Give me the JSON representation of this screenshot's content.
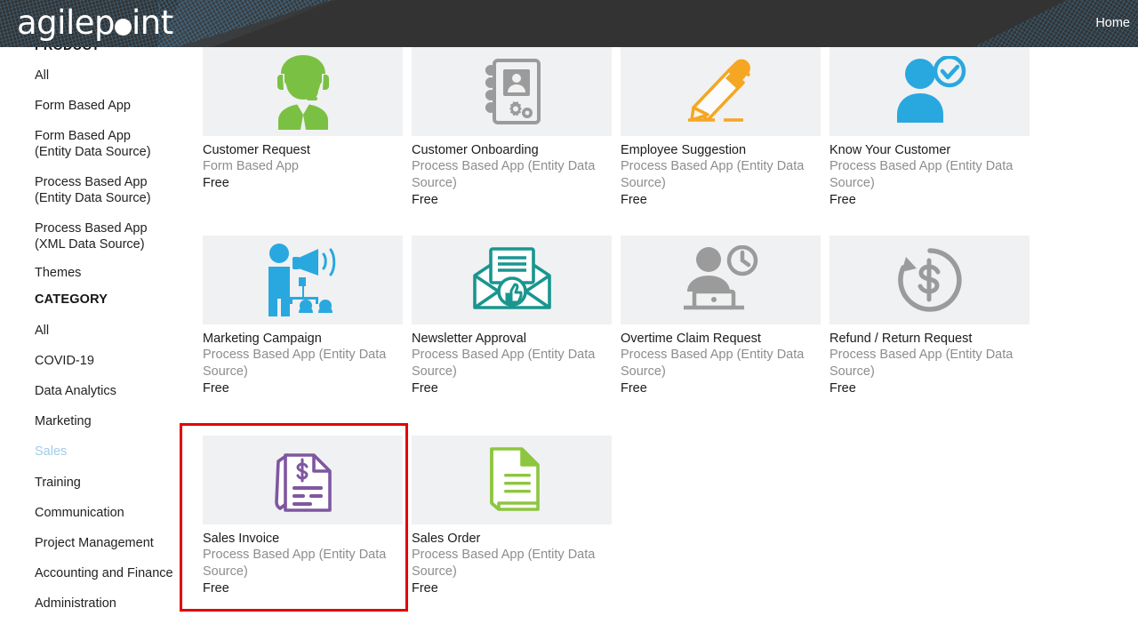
{
  "header": {
    "logo_text": "agilepoint",
    "logo_parts": {
      "pre": "agilep",
      "post": "int"
    },
    "nav": [
      {
        "label": "Home",
        "name": "home-link"
      }
    ],
    "bg_color": "#333333",
    "accent_color": "#4684b0"
  },
  "sidebar": {
    "groups": [
      {
        "title": "PRODUCT",
        "clipped": true,
        "items": [
          {
            "label": "All",
            "selected": false
          },
          {
            "label": "Form Based App",
            "selected": false
          },
          {
            "label": "Form Based App (Entity Data Source)",
            "selected": false
          },
          {
            "label": "Process Based App (Entity Data Source)",
            "selected": false
          },
          {
            "label": "Process Based App (XML Data Source)",
            "selected": false
          },
          {
            "label": "Themes",
            "selected": false
          }
        ]
      },
      {
        "title": "CATEGORY",
        "clipped": false,
        "items": [
          {
            "label": "All",
            "selected": false
          },
          {
            "label": "COVID-19",
            "selected": false
          },
          {
            "label": "Data Analytics",
            "selected": false
          },
          {
            "label": "Marketing",
            "selected": false
          },
          {
            "label": "Sales",
            "selected": true
          },
          {
            "label": "Training",
            "selected": false
          },
          {
            "label": "Communication",
            "selected": false
          },
          {
            "label": "Project Management",
            "selected": false
          },
          {
            "label": "Accounting and Finance",
            "selected": false
          },
          {
            "label": "Administration",
            "selected": false
          }
        ]
      }
    ],
    "selected_color": "#9fcce8"
  },
  "main": {
    "tiles": [
      {
        "title": "Customer Request",
        "subtitle": "Form Based App",
        "price": "Free",
        "icon": "headset-agent-icon",
        "icon_color": "#7ac143"
      },
      {
        "title": "Customer Onboarding",
        "subtitle": "Process Based App (Entity Data Source)",
        "price": "Free",
        "icon": "contact-book-gear-icon",
        "icon_color": "#9b9b9b"
      },
      {
        "title": "Employee Suggestion",
        "subtitle": "Process Based App (Entity Data Source)",
        "price": "Free",
        "icon": "pencil-writing-icon",
        "icon_color": "#f5a623"
      },
      {
        "title": "Know Your Customer",
        "subtitle": "Process Based App (Entity Data Source)",
        "price": "Free",
        "icon": "user-verified-icon",
        "icon_color": "#29a8e0"
      },
      {
        "title": "Marketing Campaign",
        "subtitle": "Process Based App (Entity Data Source)",
        "price": "Free",
        "icon": "megaphone-audience-icon",
        "icon_color": "#29a8e0"
      },
      {
        "title": "Newsletter Approval",
        "subtitle": "Process Based App (Entity Data Source)",
        "price": "Free",
        "icon": "envelope-thumbsup-icon",
        "icon_color": "#18968f"
      },
      {
        "title": "Overtime Claim Request",
        "subtitle": "Process Based App (Entity Data Source)",
        "price": "Free",
        "icon": "worker-clock-icon",
        "icon_color": "#9b9b9b"
      },
      {
        "title": "Refund / Return Request",
        "subtitle": "Process Based App (Entity Data Source)",
        "price": "Free",
        "icon": "refund-dollar-icon",
        "icon_color": "#9b9b9b"
      },
      {
        "title": "Sales Invoice",
        "subtitle": "Process Based App (Entity Data Source)",
        "price": "Free",
        "icon": "invoice-dollar-icon",
        "icon_color": "#7e57a0",
        "highlighted": true
      },
      {
        "title": "Sales Order",
        "subtitle": "Process Based App (Entity Data Source)",
        "price": "Free",
        "icon": "document-lines-icon",
        "icon_color": "#8dc63f"
      }
    ],
    "highlight": {
      "target": "Sales Invoice",
      "color": "#e30000"
    },
    "thumb_bg": "#f0f1f2"
  }
}
